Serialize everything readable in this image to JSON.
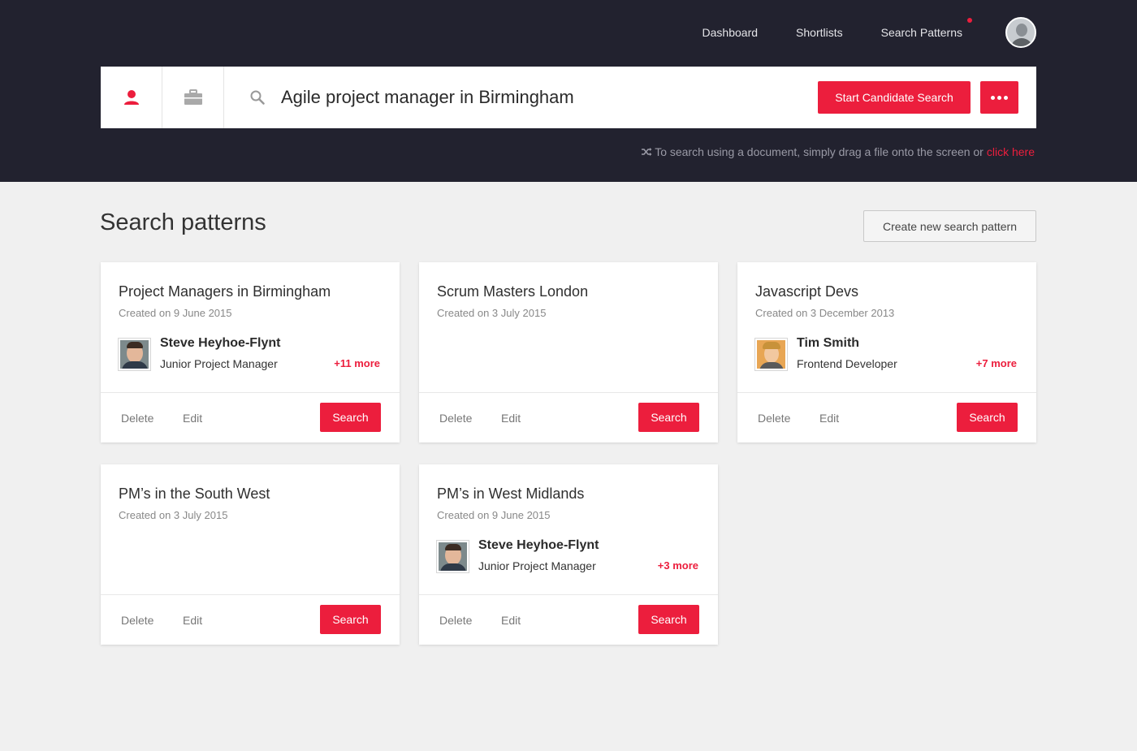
{
  "nav": {
    "items": [
      "Dashboard",
      "Shortlists",
      "Search Patterns"
    ]
  },
  "search": {
    "query": "Agile project manager in Birmingham",
    "start_label": "Start Candidate Search",
    "hint_text": "To search using a document, simply drag a file onto the screen or",
    "hint_link": "click here"
  },
  "page": {
    "title": "Search patterns",
    "create_label": "Create new search pattern"
  },
  "actions": {
    "delete": "Delete",
    "edit": "Edit",
    "search": "Search"
  },
  "cards": [
    {
      "title": "Project Managers in Birmingham",
      "date": "Created on 9 June 2015",
      "candidate": {
        "name": "Steve Heyhoe-Flynt",
        "role": "Junior Project Manager",
        "more": "+11 more"
      }
    },
    {
      "title": "Scrum Masters London",
      "date": "Created on 3 July 2015"
    },
    {
      "title": "Javascript Devs",
      "date": "Created on 3 December 2013",
      "candidate": {
        "name": "Tim Smith",
        "role": "Frontend Developer",
        "more": "+7 more"
      }
    },
    {
      "title": "PM’s in the South West",
      "date": "Created on 3 July 2015"
    },
    {
      "title": "PM’s in West Midlands",
      "date": "Created on 9 June 2015",
      "candidate": {
        "name": "Steve Heyhoe-Flynt",
        "role": "Junior Project Manager",
        "more": "+3 more"
      }
    }
  ],
  "colors": {
    "header_bg": "#22222f",
    "accent": "#ec1e3d",
    "page_bg": "#f0f0f0"
  }
}
